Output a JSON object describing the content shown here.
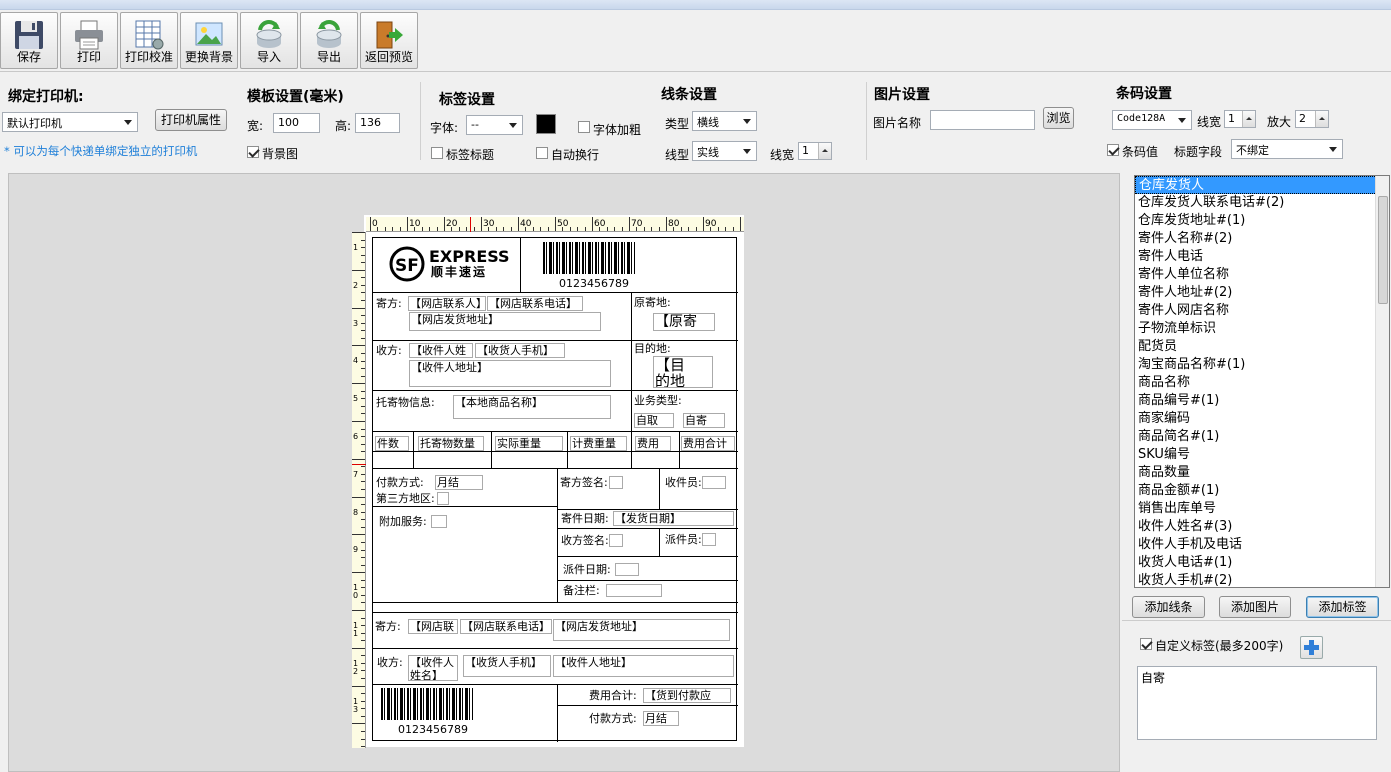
{
  "toolbar": {
    "buttons": [
      {
        "label": "保存",
        "icon": "save-icon"
      },
      {
        "label": "打印",
        "icon": "printer-icon"
      },
      {
        "label": "打印校准",
        "icon": "calibrate-icon"
      },
      {
        "label": "更换背景",
        "icon": "image-icon"
      },
      {
        "label": "导入",
        "icon": "import-icon"
      },
      {
        "label": "导出",
        "icon": "export-icon"
      },
      {
        "label": "返回预览",
        "icon": "exit-door-icon"
      }
    ]
  },
  "printer": {
    "title": "绑定打印机:",
    "selected": "默认打印机",
    "props_button": "打印机属性",
    "hint": "* 可以为每个快递单绑定独立的打印机"
  },
  "template": {
    "title": "模板设置(毫米)",
    "width_label": "宽:",
    "width_value": "100",
    "height_label": "高:",
    "height_value": "136",
    "bg_label": "背景图"
  },
  "label": {
    "title": "标签设置",
    "font_label": "字体:",
    "font_value": "--",
    "bold_label": "字体加粗",
    "title_label": "标签标题",
    "wrap_label": "自动换行",
    "color": "#000000"
  },
  "line": {
    "title": "线条设置",
    "type_label": "类型",
    "type_value": "横线",
    "style_label": "线型",
    "style_value": "实线",
    "width_label": "线宽",
    "width_value": "1"
  },
  "image": {
    "title": "图片设置",
    "name_label": "图片名称",
    "browse": "浏览"
  },
  "barcode": {
    "title": "条码设置",
    "type_value": "Code128A",
    "width_label": "线宽",
    "width_value": "1",
    "zoom_label": "放大",
    "zoom_value": "2",
    "value_label": "条码值",
    "field_label": "标题字段",
    "field_value": "不绑定"
  },
  "waybill": {
    "brand": "EXPRESS",
    "brand_cn": "顺丰速运",
    "barcode_number": "0123456789",
    "sender_label": "寄方:",
    "sender_contact": "【网店联系人】",
    "sender_phone": "【网店联系电话】",
    "sender_addr": "【网店发货地址】",
    "origin_label": "原寄地:",
    "origin_value": "【原寄",
    "recv_label": "收方:",
    "recv_name": "【收件人姓",
    "recv_phone": "【收货人手机】",
    "recv_addr": "【收件人地址】",
    "dest_label": "目的地:",
    "dest_value_1": "【目",
    "dest_value_2": "的地",
    "goods_label": "托寄物信息:",
    "goods_value": "【本地商品名称】",
    "biz_label": "业务类型:",
    "biz_self_pick": "自取",
    "biz_self_send": "自寄",
    "col_pieces": "件数",
    "col_qty": "托寄物数量",
    "col_actual": "实际重量",
    "col_billed": "计费重量",
    "col_fee": "费用",
    "col_total": "费用合计",
    "pay_label": "付款方式:",
    "pay_value": "月结",
    "third_label": "第三方地区:",
    "sender_sign": "寄方签名:",
    "collector": "收件员:",
    "extra_label": "附加服务:",
    "send_date": "寄件日期:",
    "send_date_value": "【发货日期】",
    "recv_sign": "收方签名:",
    "deliverer": "派件员:",
    "deliver_date": "派件日期:",
    "remark": "备注栏:",
    "s2_sender_label": "寄方:",
    "s2_sender_contact": "【网店联",
    "s2_sender_phone": "【网店联系电话】",
    "s2_sender_addr": "【网店发货地址】",
    "s2_recv_label": "收方:",
    "s2_recv_name_1": "【收件人",
    "s2_recv_name_2": "姓名】",
    "s2_recv_phone": "【收货人手机】",
    "s2_recv_addr": "【收件人地址】",
    "fee_total": "费用合计:",
    "fee_total_value": "【货到付款应",
    "pay2_label": "付款方式:",
    "pay2_value": "月结"
  },
  "ruler": {
    "top": [
      "0",
      "10",
      "20",
      "30",
      "40",
      "50",
      "60",
      "70",
      "80",
      "90"
    ],
    "left": [
      "1",
      "2",
      "3",
      "4",
      "5",
      "6",
      "7",
      "8",
      "9",
      "10",
      "11",
      "12",
      "13"
    ]
  },
  "fields": [
    "仓库发货人",
    "仓库发货人联系电话#(2)",
    "仓库发货地址#(1)",
    "寄件人名称#(2)",
    "寄件人电话",
    "寄件人单位名称",
    "寄件人地址#(2)",
    "寄件人网店名称",
    "子物流单标识",
    "配货员",
    "淘宝商品名称#(1)",
    "商品名称",
    "商品编号#(1)",
    "商家编码",
    "商品简名#(1)",
    "SKU编号",
    "商品数量",
    "商品金额#(1)",
    "销售出库单号",
    "收件人姓名#(3)",
    "收件人手机及电话",
    "收货人电话#(1)",
    "收货人手机#(2)"
  ],
  "actions": {
    "add_line": "添加线条",
    "add_image": "添加图片",
    "add_label": "添加标签"
  },
  "custom": {
    "label": "自定义标签(最多200字)",
    "text": "自寄"
  }
}
